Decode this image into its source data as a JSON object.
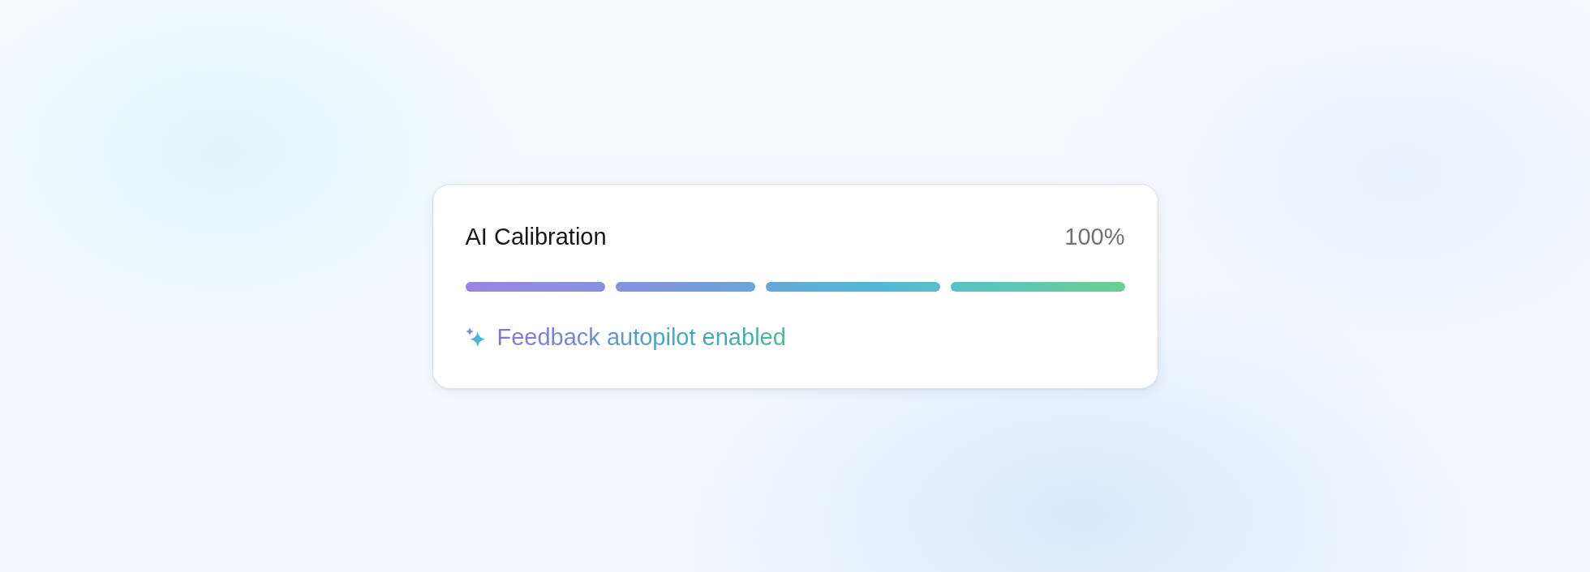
{
  "card": {
    "title": "AI Calibration",
    "percent": "100%",
    "progress": {
      "level": 1
    },
    "status": {
      "text": "Feedback autopilot enabled"
    }
  }
}
